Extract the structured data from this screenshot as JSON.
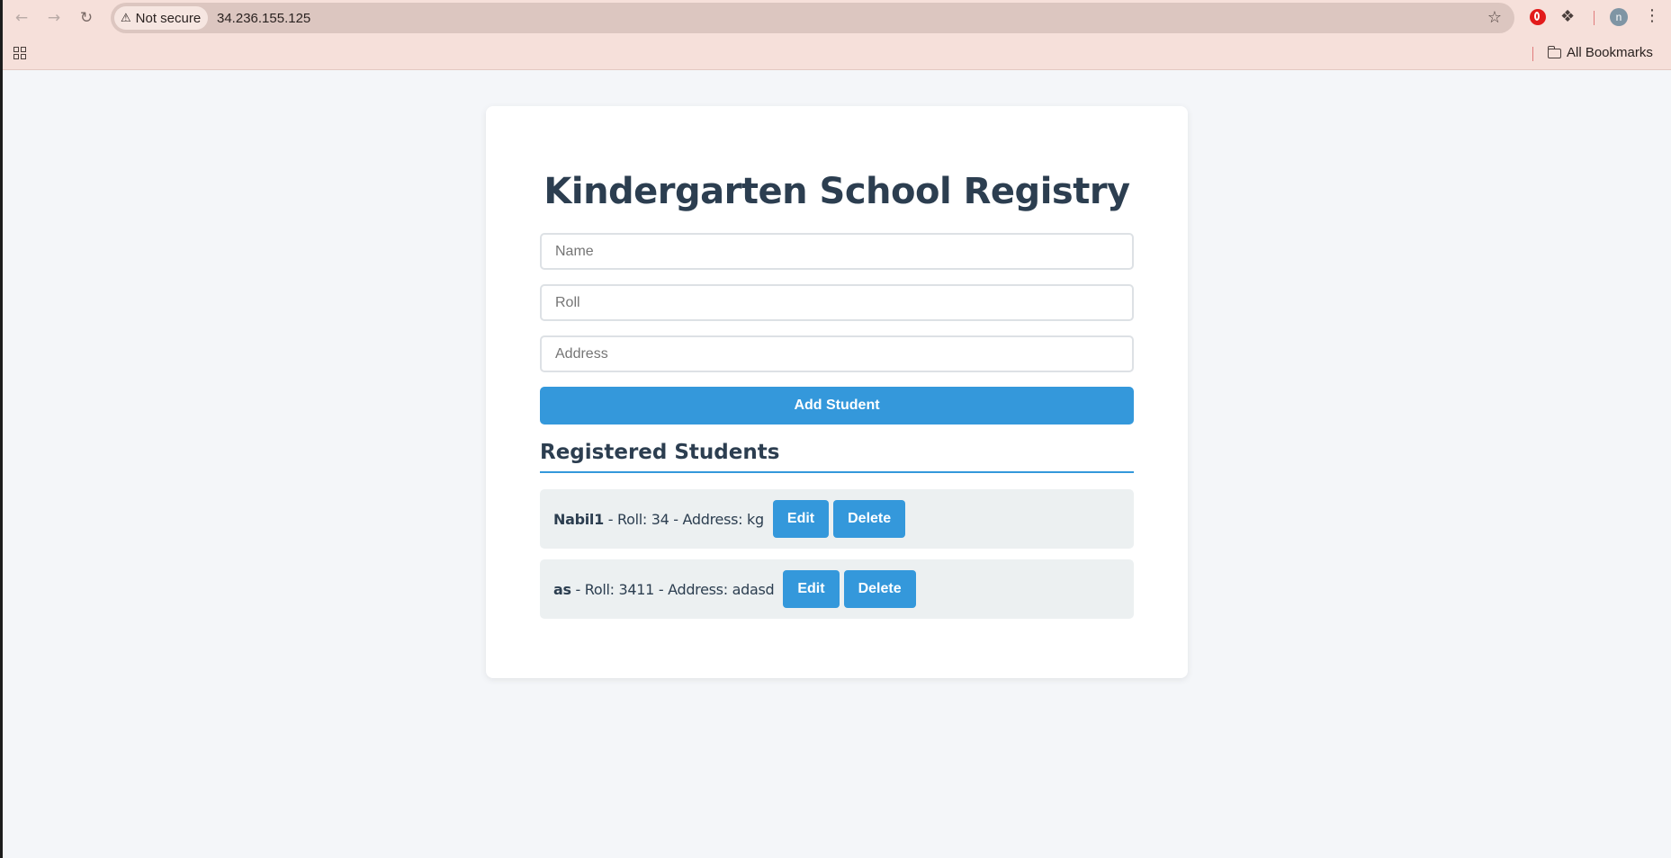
{
  "browser": {
    "security_label": "Not secure",
    "url": "34.236.155.125",
    "bookmarks_label": "All Bookmarks",
    "profile_initial": "n"
  },
  "page": {
    "title": "Kindergarten School Registry",
    "form": {
      "name_placeholder": "Name",
      "roll_placeholder": "Roll",
      "address_placeholder": "Address",
      "submit_label": "Add Student"
    },
    "list_title": "Registered Students",
    "students": [
      {
        "name": "Nabil1",
        "details": " - Roll: 34 - Address: kg",
        "edit_label": "Edit",
        "delete_label": "Delete"
      },
      {
        "name": "as",
        "details": " - Roll: 3411 - Address: adasd",
        "edit_label": "Edit",
        "delete_label": "Delete"
      }
    ]
  },
  "colors": {
    "accent": "#3498db",
    "heading": "#2c3e50",
    "item_background": "#ecf0f1",
    "page_background": "#f4f6f9",
    "chrome_background": "#f6e0da"
  }
}
